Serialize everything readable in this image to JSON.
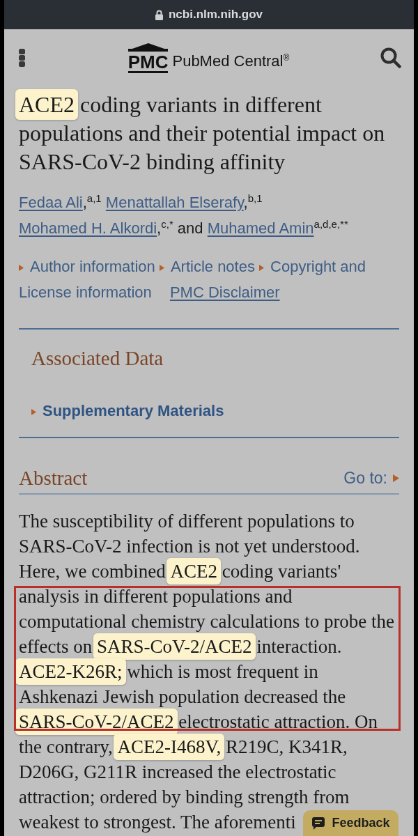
{
  "address_bar": {
    "url": "ncbi.nlm.nih.gov"
  },
  "header": {
    "logo_mark": "PMC",
    "logo_text": "PubMed Central$^{®}$"
  },
  "title": [
    {
      "text": "ACE2",
      "highlighted": true
    },
    {
      "text": " coding variants in different populations and their potential impact on SARS-CoV-2 binding affinity",
      "highlighted": false
    }
  ],
  "authors": [
    {
      "kind": "author",
      "name": "Fedaa Ali",
      "punct": ",",
      "marks": "a,1"
    },
    {
      "kind": "author",
      "name": "Menattallah Elserafy",
      "punct": ",",
      "marks": "b,1"
    },
    {
      "kind": "author",
      "name": "Mohamed H. Alkordi",
      "punct": ",",
      "marks": "c,*"
    },
    {
      "kind": "conjunction",
      "text": "and"
    },
    {
      "kind": "author",
      "name": "Muhamed Amin",
      "marks": "a,d,e,**"
    }
  ],
  "article_links": [
    {
      "kind": "toggle",
      "parts": [
        "Author information"
      ]
    },
    {
      "kind": "toggle",
      "parts": [
        "Article notes"
      ]
    },
    {
      "kind": "toggle",
      "parts": [
        "Copyright and",
        "License information"
      ]
    },
    {
      "kind": "link",
      "parts": [
        "PMC Disclaimer"
      ]
    }
  ],
  "associated_data": {
    "heading": "Associated Data",
    "toggle": "Supplementary Materials"
  },
  "abstract": {
    "heading": "Abstract",
    "goto": "Go to:",
    "segments": [
      {
        "text": "The susceptibility of different populations to SARS-CoV-2 infection is not yet understood. Here, we combined ",
        "highlighted": false
      },
      {
        "text": "ACE2",
        "highlighted": true
      },
      {
        "text": " coding variants' analysis in different populations and computational chemistry calculations to probe the effects on ",
        "highlighted": false
      },
      {
        "text": "SARS-CoV-2/ACE2",
        "highlighted": true
      },
      {
        "text": " interaction. ",
        "highlighted": false
      },
      {
        "text": "ACE2-K26R;",
        "highlighted": true
      },
      {
        "text": " which is most frequent in Ashkenazi Jewish population decreased the ",
        "highlighted": false
      },
      {
        "text": "SARS-CoV-2/ACE2",
        "highlighted": true
      },
      {
        "text": " electrostatic attraction. On the contrary, ",
        "highlighted": false
      },
      {
        "text": "ACE2-I468V,",
        "highlighted": true
      },
      {
        "text": " R219C, K341R, D206G, G211R increased the electrostatic attraction; ordered by binding strength from weakest to strongest. The aforementi",
        "highlighted": false
      }
    ]
  },
  "feedback": {
    "label": "Feedback"
  }
}
